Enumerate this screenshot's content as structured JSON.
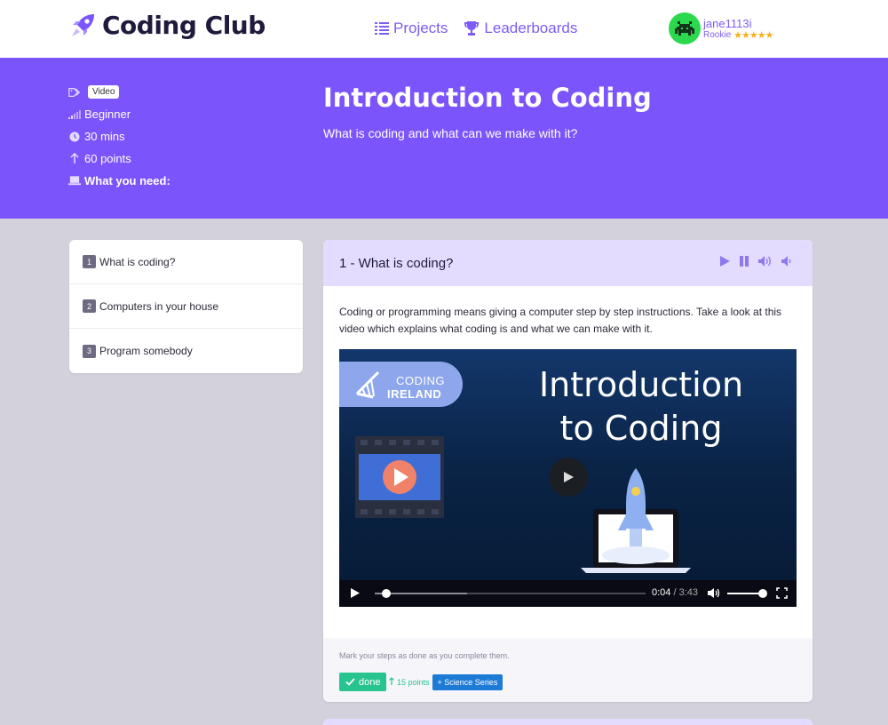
{
  "header": {
    "brand": "Coding Club",
    "nav": [
      {
        "label": "Projects",
        "icon": "list-icon"
      },
      {
        "label": "Leaderboards",
        "icon": "trophy-icon"
      }
    ],
    "user": {
      "name": "jane1113i",
      "rank": "Rookie",
      "stars": "★★★★★"
    }
  },
  "hero": {
    "tag": "Video",
    "level": "Beginner",
    "duration": "30 mins",
    "points": "60 points",
    "needs_label": "What you need:",
    "title": "Introduction to Coding",
    "subtitle": "What is coding and what can we make with it?"
  },
  "steps": [
    {
      "num": "1",
      "label": "What is coding?"
    },
    {
      "num": "2",
      "label": "Computers in your house"
    },
    {
      "num": "3",
      "label": "Program somebody"
    }
  ],
  "card": {
    "title": "1 - What is coding?",
    "text": "Coding or programming means giving a computer step by step instructions. Take a look at this video which explains what coding is and what we can make with it.",
    "video": {
      "badge_line1": "CODING",
      "badge_line2": "IRELAND",
      "title_line1": "Introduction",
      "title_line2": "to Coding",
      "current_time": "0:04",
      "time_sep": " / ",
      "duration": "3:43"
    },
    "footer": {
      "note": "Mark your steps as done as you complete them.",
      "done_label": "done",
      "points": "15 points",
      "series": "+ Science Series"
    }
  },
  "colors": {
    "brand": "#7c54fb",
    "accent": "#7c5cf5",
    "card_header": "#e3dcff",
    "success": "#28c490",
    "series": "#1d7bd6",
    "background": "#d3d1dc"
  }
}
